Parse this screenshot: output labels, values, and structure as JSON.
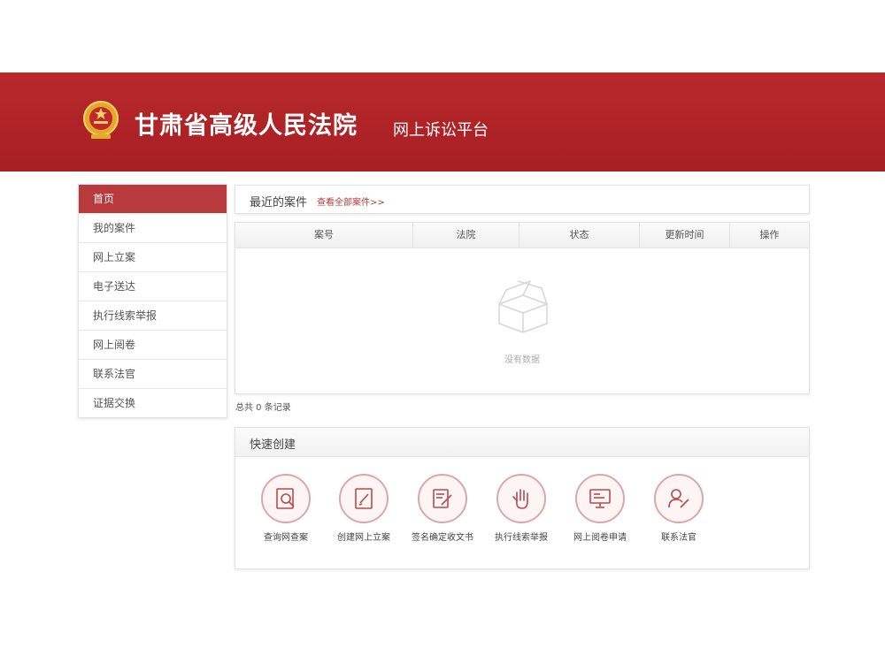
{
  "header": {
    "court_name": "甘肃省高级人民法院",
    "platform_name": "网上诉讼平台",
    "emblem_icon": "court-emblem-icon",
    "brand_color": "#ae2226"
  },
  "sidebar": {
    "items": [
      {
        "label": "首页",
        "active": true
      },
      {
        "label": "我的案件"
      },
      {
        "label": "网上立案"
      },
      {
        "label": "电子送达"
      },
      {
        "label": "执行线索举报"
      },
      {
        "label": "网上阅卷"
      },
      {
        "label": "联系法官"
      },
      {
        "label": "证据交换"
      }
    ]
  },
  "recent_cases": {
    "title": "最近的案件",
    "view_all_link": "查看全部案件>>",
    "columns": [
      "案号",
      "法院",
      "状态",
      "更新时间",
      "操作"
    ],
    "empty_text": "没有数据",
    "empty_icon": "empty-box-icon",
    "total_text": "总共 0 条记录"
  },
  "quick_create": {
    "title": "快速创建",
    "items": [
      {
        "label": "查询网查案",
        "icon": "search-document-icon"
      },
      {
        "label": "创建网上立案",
        "icon": "edit-document-icon"
      },
      {
        "label": "签名确定收文书",
        "icon": "sign-document-icon"
      },
      {
        "label": "执行线索举报",
        "icon": "raised-hand-icon"
      },
      {
        "label": "网上阅卷申请",
        "icon": "monitor-document-icon"
      },
      {
        "label": "联系法官",
        "icon": "judge-contact-icon"
      }
    ]
  }
}
